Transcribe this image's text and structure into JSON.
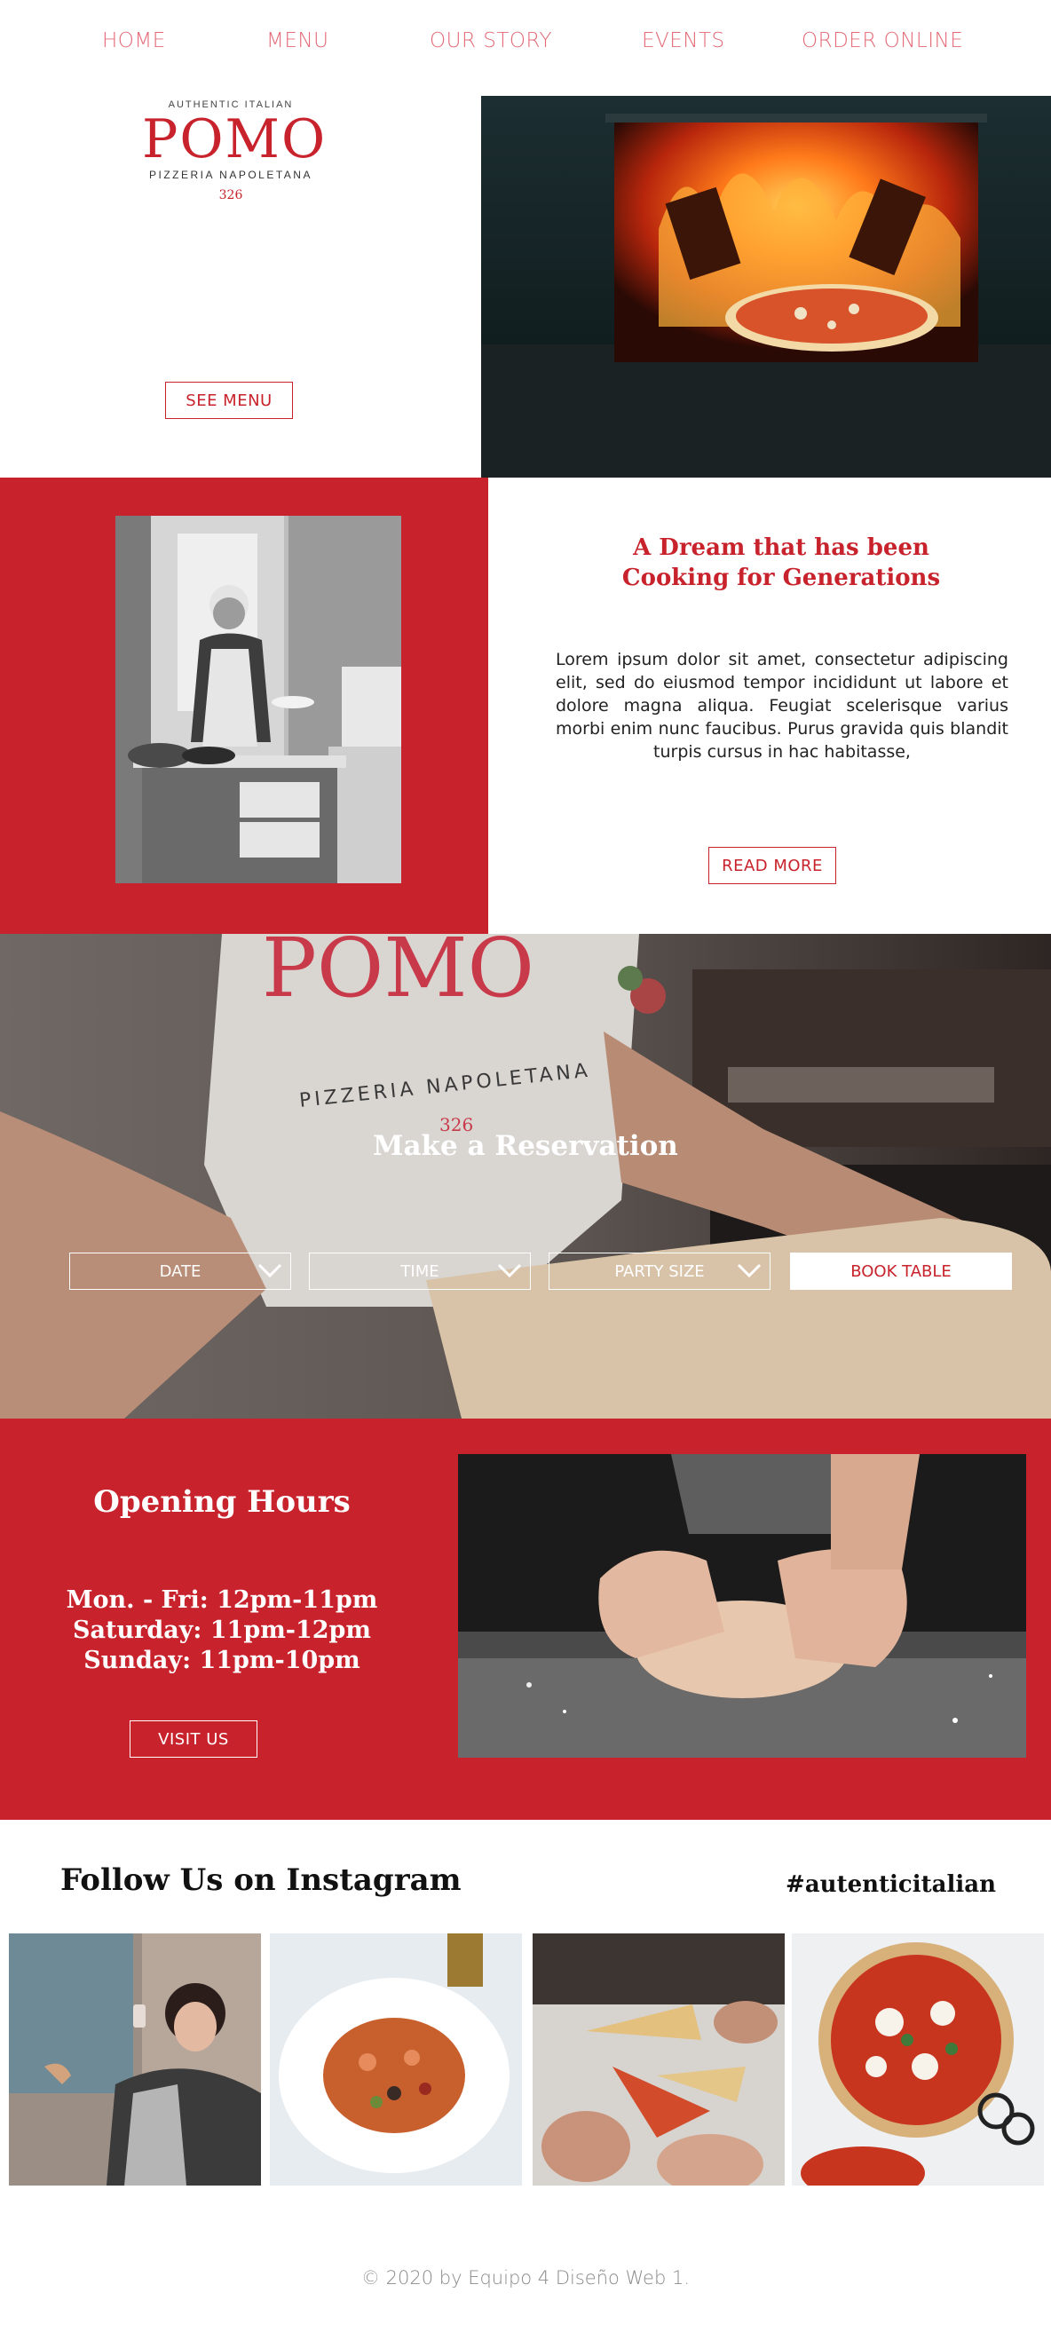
{
  "nav": {
    "items": [
      "HOME",
      "MENU",
      "OUR STORY",
      "EVENTS",
      "ORDER ONLINE"
    ]
  },
  "logo": {
    "tagline": "AUTHENTIC ITALIAN",
    "name": "POMO",
    "subtitle": "PIZZERIA NAPOLETANA",
    "number": "326"
  },
  "hero": {
    "button": "SEE MENU"
  },
  "story": {
    "title_line1": "A Dream that has been",
    "title_line2": "Cooking for Generations",
    "body": "Lorem ipsum dolor sit amet, consectetur adipiscing elit, sed do eiusmod tempor incididunt ut labore et dolore magna aliqua. Feugiat scelerisque varius morbi enim nunc faucibus. Purus gravida quis blandit turpis cursus in hac habitasse,",
    "button": "READ MORE"
  },
  "reservation": {
    "title": "Make a Reservation",
    "date": "DATE",
    "time": "TIME",
    "party": "PARTY SIZE",
    "button": "BOOK TABLE",
    "shirt_logo": "POMO",
    "shirt_sub": "PIZZERIA NAPOLETANA",
    "shirt_num": "326",
    "shirt_sleeve": "ZERIA\nPOLETANA"
  },
  "hours": {
    "title": "Opening Hours",
    "line1": "Mon. - Fri:  12pm-11pm",
    "line2": "Saturday:  11pm-12pm",
    "line3": "Sunday:  11pm-10pm",
    "button": "VISIT US"
  },
  "instagram": {
    "title": "Follow Us on Instagram",
    "hashtag": "#autenticitalian"
  },
  "footer": {
    "text": "© 2020 by Equipo 4 Diseño Web 1."
  },
  "colors": {
    "brand_red": "#c8232c",
    "nav_pink": "#e36b77"
  }
}
